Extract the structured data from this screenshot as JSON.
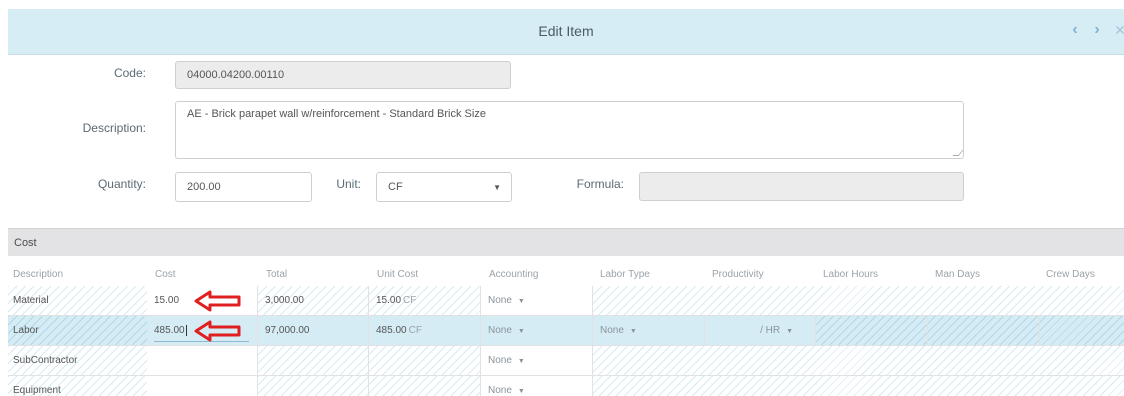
{
  "dialog": {
    "title": "Edit Item",
    "prev_icon": "chevron-left-icon",
    "next_icon": "chevron-right-icon",
    "close_icon": "close-icon"
  },
  "form": {
    "code_label": "Code:",
    "code_value": "04000.04200.00110",
    "description_label": "Description:",
    "description_value": "AE - Brick parapet wall w/reinforcement - Standard Brick Size",
    "quantity_label": "Quantity:",
    "quantity_value": "200.00",
    "unit_label": "Unit:",
    "unit_value": "CF",
    "formula_label": "Formula:",
    "formula_value": ""
  },
  "cost": {
    "section_title": "Cost",
    "columns": [
      "Description",
      "Cost",
      "Total",
      "Unit Cost",
      "Accounting",
      "Labor Type",
      "Productivity",
      "Labor Hours",
      "Man Days",
      "Crew Days"
    ],
    "rows": [
      {
        "description": "Material",
        "cost": "15.00",
        "total": "3,000.00",
        "unit_cost": "15.00",
        "unit_suffix": "CF",
        "accounting": "None"
      },
      {
        "description": "Labor",
        "cost": "485.00",
        "total": "97,000.00",
        "unit_cost": "485.00",
        "unit_suffix": "CF",
        "accounting": "None",
        "labor_type": "None",
        "productivity": "/ HR"
      },
      {
        "description": "SubContractor",
        "cost": "",
        "total": "",
        "unit_cost": "",
        "unit_suffix": "",
        "accounting": "None"
      },
      {
        "description": "Equipment",
        "cost": "",
        "total": "",
        "unit_cost": "",
        "unit_suffix": "",
        "accounting": "None"
      }
    ]
  },
  "annotations": {
    "arrow_color": "#e02020",
    "arrow_icon": "left-arrow-icon"
  }
}
